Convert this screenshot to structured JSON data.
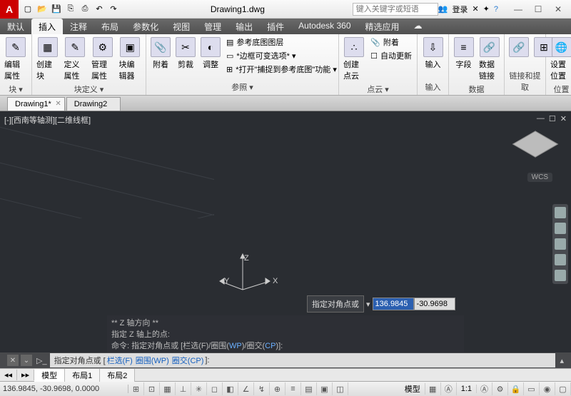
{
  "titlebar": {
    "filename": "Drawing1.dwg",
    "search_placeholder": "键入关键字或短语",
    "login": "登录"
  },
  "ribbon_tabs": [
    "默认",
    "插入",
    "注释",
    "布局",
    "参数化",
    "视图",
    "管理",
    "输出",
    "插件",
    "Autodesk 360",
    "精选应用"
  ],
  "ribbon_active_tab": 1,
  "ribbon_groups": {
    "block": {
      "title": "块 ▾",
      "btn": "编辑属性"
    },
    "blockdef": {
      "title": "块定义 ▾",
      "btns": [
        "创建块",
        "定义属性",
        "管理属性",
        "块编辑器"
      ]
    },
    "reference": {
      "title": "参照 ▾",
      "btns": [
        "附着",
        "剪裁",
        "调整"
      ],
      "lines": [
        "参考底图图层",
        "*边框可变选项* ▾",
        "*打开\"捕捉到参考底图\"功能 ▾"
      ]
    },
    "pointcloud": {
      "title": "点云 ▾",
      "btn": "创建点云",
      "lines": [
        "附着",
        "自动更新"
      ]
    },
    "import": {
      "title": "输入",
      "btn": "输入"
    },
    "data": {
      "title": "数据",
      "btns": [
        "字段",
        "数据链接"
      ]
    },
    "link": {
      "title": "链接和提取"
    },
    "location": {
      "title": "位置",
      "btn": "设置位置"
    }
  },
  "file_tabs": [
    "Drawing1*",
    "Drawing2"
  ],
  "active_file_tab": 0,
  "viewport": {
    "label": "[-][西南等轴测][二维线框]",
    "wcs": "WCS",
    "axis_labels": {
      "x": "X",
      "y": "Y",
      "z": "Z"
    }
  },
  "dynamic_input": {
    "prompt": "指定对角点或",
    "field1": "136.9845",
    "field2": "-30.9698"
  },
  "command_history": {
    "l1": "** Z 轴方向 **",
    "l2": "指定 Z 轴上的点:",
    "l3_a": "命令: 指定对角点或 [栏选(F)/圈围(",
    "l3_wp": "WP",
    "l3_b": ")/圈交(",
    "l3_cp": "CP",
    "l3_c": ")]:"
  },
  "command_line": {
    "prompt_a": "指定对角点或 [",
    "opt1": "栏选(F)",
    "sep": " ",
    "opt2": "圈围(WP)",
    "opt3": "圈交(CP)",
    "prompt_b": "]:"
  },
  "layout_tabs": {
    "model": "模型",
    "l1": "布局1",
    "l2": "布局2"
  },
  "statusbar": {
    "coords": "136.9845, -30.9698, 0.0000",
    "model": "模型",
    "ratio": "1:1"
  },
  "colors": {
    "accent": "#c00",
    "green_axis": "#3c8a3c",
    "red_axis": "#9c3a3a"
  }
}
